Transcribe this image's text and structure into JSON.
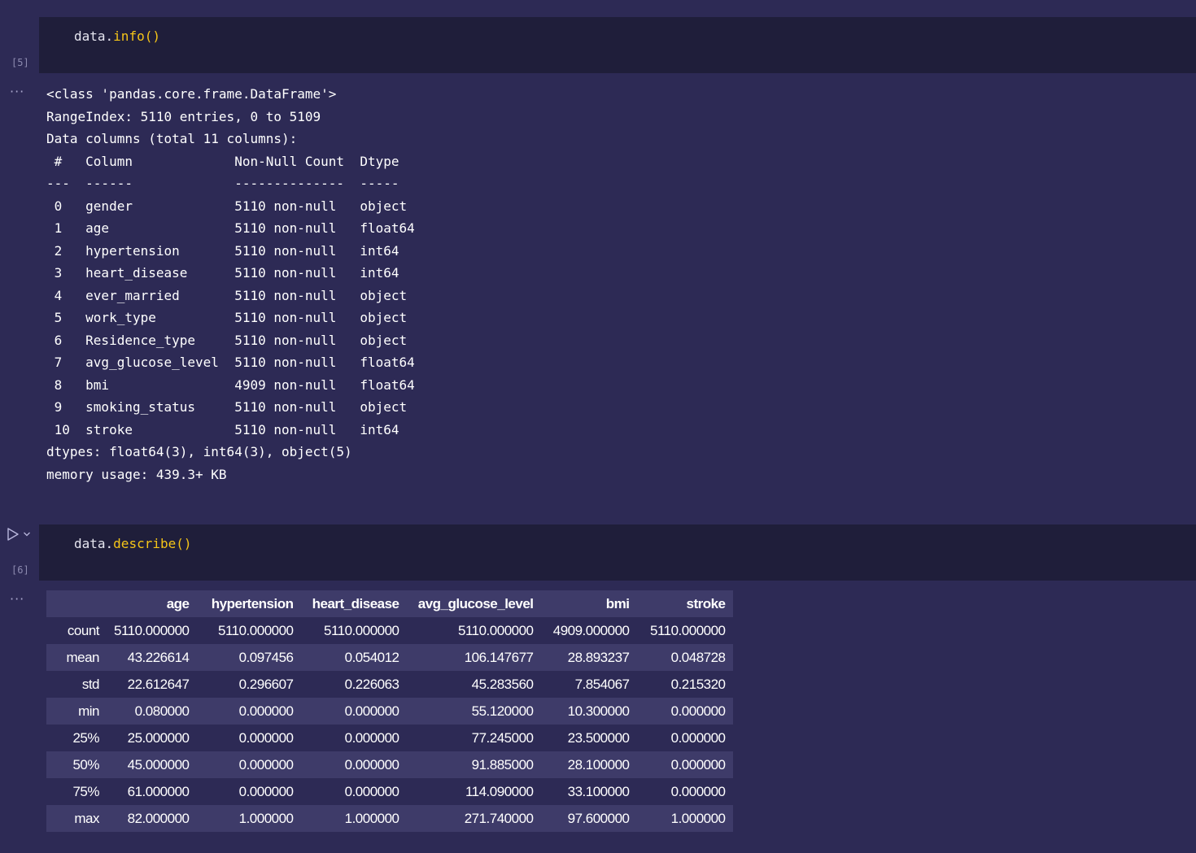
{
  "cells": [
    {
      "exec_count": "[5]",
      "code_obj": "data.",
      "code_fn": "info()",
      "output_ellipsis": "···",
      "output_text": "<class 'pandas.core.frame.DataFrame'>\nRangeIndex: 5110 entries, 0 to 5109\nData columns (total 11 columns):\n #   Column             Non-Null Count  Dtype  \n---  ------             --------------  -----  \n 0   gender             5110 non-null   object \n 1   age                5110 non-null   float64\n 2   hypertension       5110 non-null   int64  \n 3   heart_disease      5110 non-null   int64  \n 4   ever_married       5110 non-null   object \n 5   work_type          5110 non-null   object \n 6   Residence_type     5110 non-null   object \n 7   avg_glucose_level  5110 non-null   float64\n 8   bmi                4909 non-null   float64\n 9   smoking_status     5110 non-null   object \n 10  stroke             5110 non-null   int64  \ndtypes: float64(3), int64(3), object(5)\nmemory usage: 439.3+ KB"
    },
    {
      "exec_count": "[6]",
      "code_obj": "data.",
      "code_fn": "describe()",
      "output_ellipsis": "···",
      "table": {
        "columns": [
          "",
          "age",
          "hypertension",
          "heart_disease",
          "avg_glucose_level",
          "bmi",
          "stroke"
        ],
        "rows": [
          [
            "count",
            "5110.000000",
            "5110.000000",
            "5110.000000",
            "5110.000000",
            "4909.000000",
            "5110.000000"
          ],
          [
            "mean",
            "43.226614",
            "0.097456",
            "0.054012",
            "106.147677",
            "28.893237",
            "0.048728"
          ],
          [
            "std",
            "22.612647",
            "0.296607",
            "0.226063",
            "45.283560",
            "7.854067",
            "0.215320"
          ],
          [
            "min",
            "0.080000",
            "0.000000",
            "0.000000",
            "55.120000",
            "10.300000",
            "0.000000"
          ],
          [
            "25%",
            "25.000000",
            "0.000000",
            "0.000000",
            "77.245000",
            "23.500000",
            "0.000000"
          ],
          [
            "50%",
            "45.000000",
            "0.000000",
            "0.000000",
            "91.885000",
            "28.100000",
            "0.000000"
          ],
          [
            "75%",
            "61.000000",
            "0.000000",
            "0.000000",
            "114.090000",
            "33.100000",
            "0.000000"
          ],
          [
            "max",
            "82.000000",
            "1.000000",
            "1.000000",
            "271.740000",
            "97.600000",
            "1.000000"
          ]
        ]
      }
    }
  ],
  "icons": {
    "run": "play-icon",
    "run_options": "chevron-down-icon"
  },
  "colors": {
    "background": "#2d2a55",
    "cell_input": "#1f1e3a",
    "function_name": "#f5c518",
    "table_stripe": "#3e3b69"
  }
}
